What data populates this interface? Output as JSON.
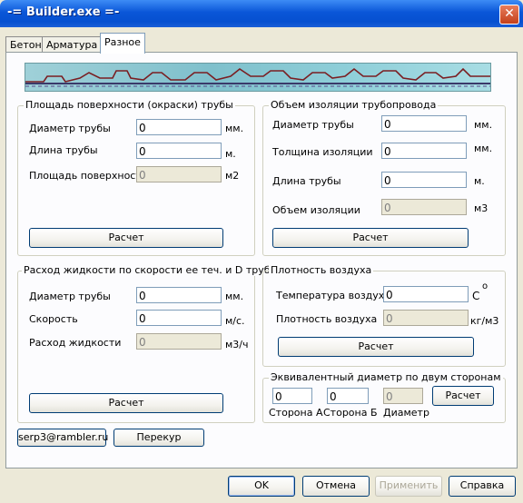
{
  "window": {
    "title": "-= Builder.exe =-",
    "close_glyph": "✕"
  },
  "tabs": [
    {
      "label": "Бетон"
    },
    {
      "label": "Арматура"
    },
    {
      "label": "Разное"
    }
  ],
  "surface": {
    "title": "Площадь поверхности (окраски) трубы",
    "diameter": {
      "label": "Диаметр трубы",
      "value": "0",
      "unit": "мм."
    },
    "length": {
      "label": "Длина трубы",
      "value": "0",
      "unit": "м."
    },
    "area": {
      "label": "Площадь поверхности",
      "value": "0",
      "unit": "м2"
    },
    "calc": "Расчет"
  },
  "insulation": {
    "title": "Объем изоляции трубопровода",
    "diameter": {
      "label": "Диаметр трубы",
      "value": "0",
      "unit": "мм."
    },
    "thickness": {
      "label": "Толщина изоляции",
      "value": "0",
      "unit": "мм."
    },
    "length": {
      "label": "Длина трубы",
      "value": "0",
      "unit": "м."
    },
    "volume": {
      "label": "Объем изоляции",
      "value": "0",
      "unit": "м3"
    },
    "calc": "Расчет"
  },
  "flow": {
    "title": "Расход жидкости по скорости ее теч. и D трубы",
    "diameter": {
      "label": "Диаметр трубы",
      "value": "0",
      "unit": "мм."
    },
    "speed": {
      "label": "Скорость",
      "value": "0",
      "unit": "м/с."
    },
    "rate": {
      "label": "Расход жидкости",
      "value": "0",
      "unit": "м3/ч"
    },
    "calc": "Расчет"
  },
  "air": {
    "title": "Плотность воздуха",
    "temp": {
      "label": "Температура воздуха",
      "value": "0",
      "unit": "С",
      "deg": "o"
    },
    "density": {
      "label": "Плотность воздуха",
      "value": "0",
      "unit": "кг/м3"
    },
    "calc": "Расчет"
  },
  "equiv": {
    "title": "Эквивалентный диаметр по двум сторонам",
    "side_a": {
      "label": "Сторона А",
      "value": "0"
    },
    "side_b": {
      "label": "Сторона Б",
      "value": "0"
    },
    "diameter": {
      "label": "Диаметр",
      "value": "0"
    },
    "calc": "Расчет"
  },
  "footer": {
    "email": "serp3@rambler.ru",
    "link": "Перекур"
  },
  "dialog_buttons": {
    "ok": "OK",
    "cancel": "Отмена",
    "apply": "Применить",
    "help": "Справка"
  }
}
